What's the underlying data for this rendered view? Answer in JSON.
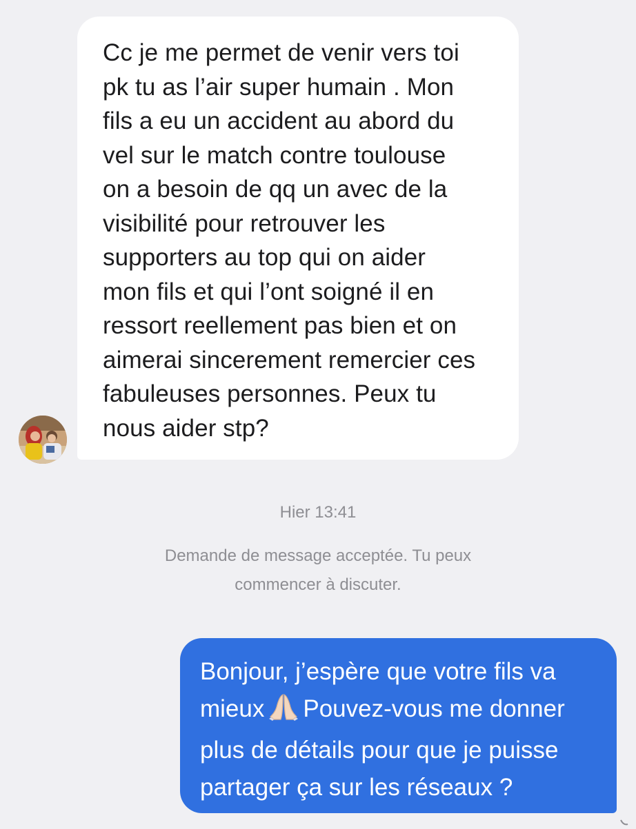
{
  "conversation": {
    "incoming_message": {
      "lines": [
        "Cc je me permet de venir vers toi",
        "pk tu as l’air super humain . Mon",
        "fils a eu un accident au abord du",
        "vel sur le match contre toulouse",
        "on a besoin de qq un avec de la",
        "visibilité pour retrouver les",
        "supporters au top qui on aider",
        "mon fils et qui l’ont soigné il en",
        "ressort reellement pas bien et on",
        "aimerai sincerement remercier ces",
        "fabuleuses personnes. Peux tu",
        "nous aider stp?"
      ]
    },
    "timestamp": "Hier 13:41",
    "notice": {
      "line1": "Demande de message acceptée. Tu peux",
      "line2": "commencer à discuter."
    },
    "outgoing_message": {
      "line1": "Bonjour, j’espère que votre fils va",
      "line2_before": "mieux",
      "line2_after": "Pouvez-vous me donner",
      "line3": "plus de détails pour que je puisse",
      "line4": "partager ça sur les réseaux ?",
      "emoji": "folded-hands-icon"
    }
  },
  "colors": {
    "background": "#f0f0f3",
    "incoming_bubble": "#ffffff",
    "outgoing_bubble": "#3070e0",
    "meta_text": "#8e8e93"
  }
}
